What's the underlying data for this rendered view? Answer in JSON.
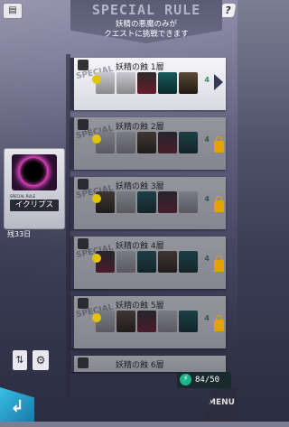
{
  "header": {
    "title": "SPECIAL RULE",
    "subtitle_line1": "妖精の悪魔のみが",
    "subtitle_line2": "クエストに挑戦できます"
  },
  "nav": {
    "help_label": "?"
  },
  "floors": [
    {
      "name": "妖精の蝕 1層",
      "special": "SPECIAL",
      "count": "4",
      "locked": false
    },
    {
      "name": "妖精の蝕 2層",
      "special": "SPECIAL",
      "count": "4",
      "locked": true
    },
    {
      "name": "妖精の蝕 3層",
      "special": "SPECIAL",
      "count": "4",
      "locked": true
    },
    {
      "name": "妖精の蝕 4層",
      "special": "SPECIAL",
      "count": "4",
      "locked": true
    },
    {
      "name": "妖精の蝕 5層",
      "special": "SPECIAL",
      "count": "4",
      "locked": true
    },
    {
      "name": "妖精の蝕 6層",
      "special": "SPECIAL",
      "count": "",
      "locked": true
    }
  ],
  "rule_card": {
    "label_small": "SPECIAL RULE",
    "name": "イクリプス",
    "days": "残33日"
  },
  "energy": {
    "value": "84/50"
  },
  "menu_label": "MENU"
}
